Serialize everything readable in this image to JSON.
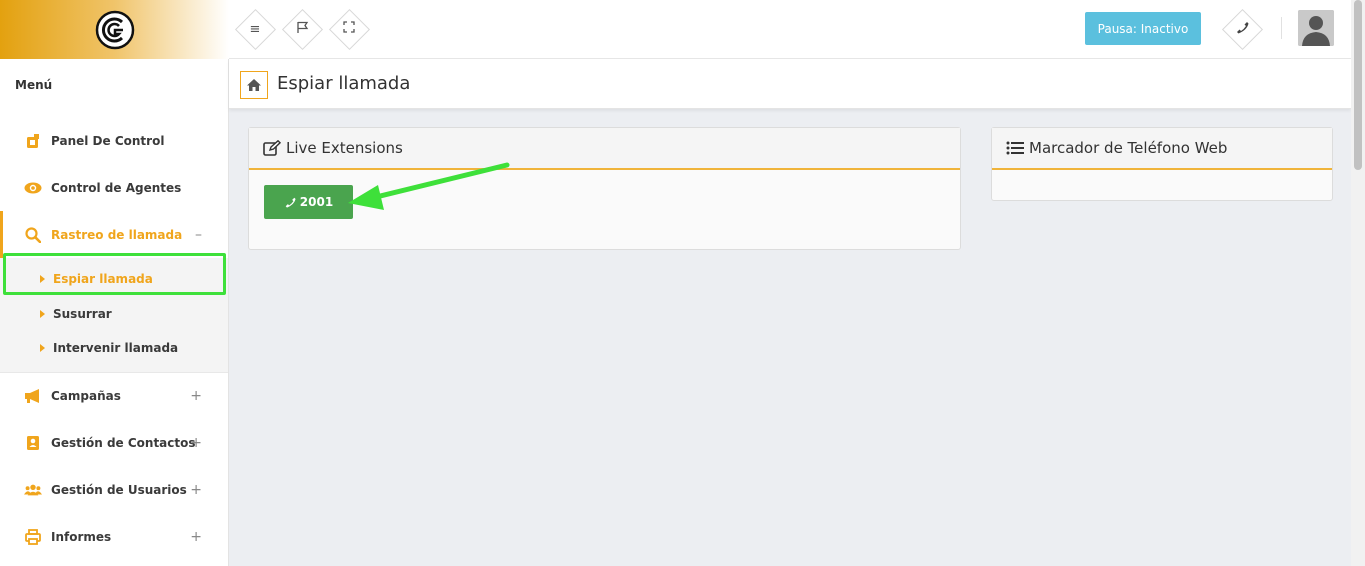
{
  "sidebar": {
    "menu_label": "Menú",
    "items": [
      {
        "label": "Panel De Control",
        "icon": "dashboard-icon",
        "toggle": ""
      },
      {
        "label": "Control de Agentes",
        "icon": "eye-icon",
        "toggle": ""
      },
      {
        "label": "Rastreo de llamada",
        "icon": "search-icon",
        "toggle": "–"
      },
      {
        "label": "Campañas",
        "icon": "megaphone-icon",
        "toggle": "+"
      },
      {
        "label": "Gestión de Contactos",
        "icon": "contact-book-icon",
        "toggle": "+"
      },
      {
        "label": "Gestión de Usuarios",
        "icon": "users-icon",
        "toggle": "+"
      },
      {
        "label": "Informes",
        "icon": "printer-icon",
        "toggle": "+"
      }
    ],
    "submenu": [
      {
        "label": "Espiar llamada"
      },
      {
        "label": "Susurrar"
      },
      {
        "label": "Intervenir llamada"
      }
    ]
  },
  "topbar": {
    "pausa_label": "Pausa: Inactivo"
  },
  "page": {
    "title": "Espiar llamada"
  },
  "panels": {
    "live_extensions": {
      "title": "Live Extensions",
      "extension": "2001"
    },
    "web_dialer": {
      "title": "Marcador de Teléfono Web"
    }
  },
  "colors": {
    "accent": "#f0a51c",
    "pausa": "#5bc0de",
    "extension_button": "#4aa44e",
    "annotation": "#3ee03a"
  }
}
